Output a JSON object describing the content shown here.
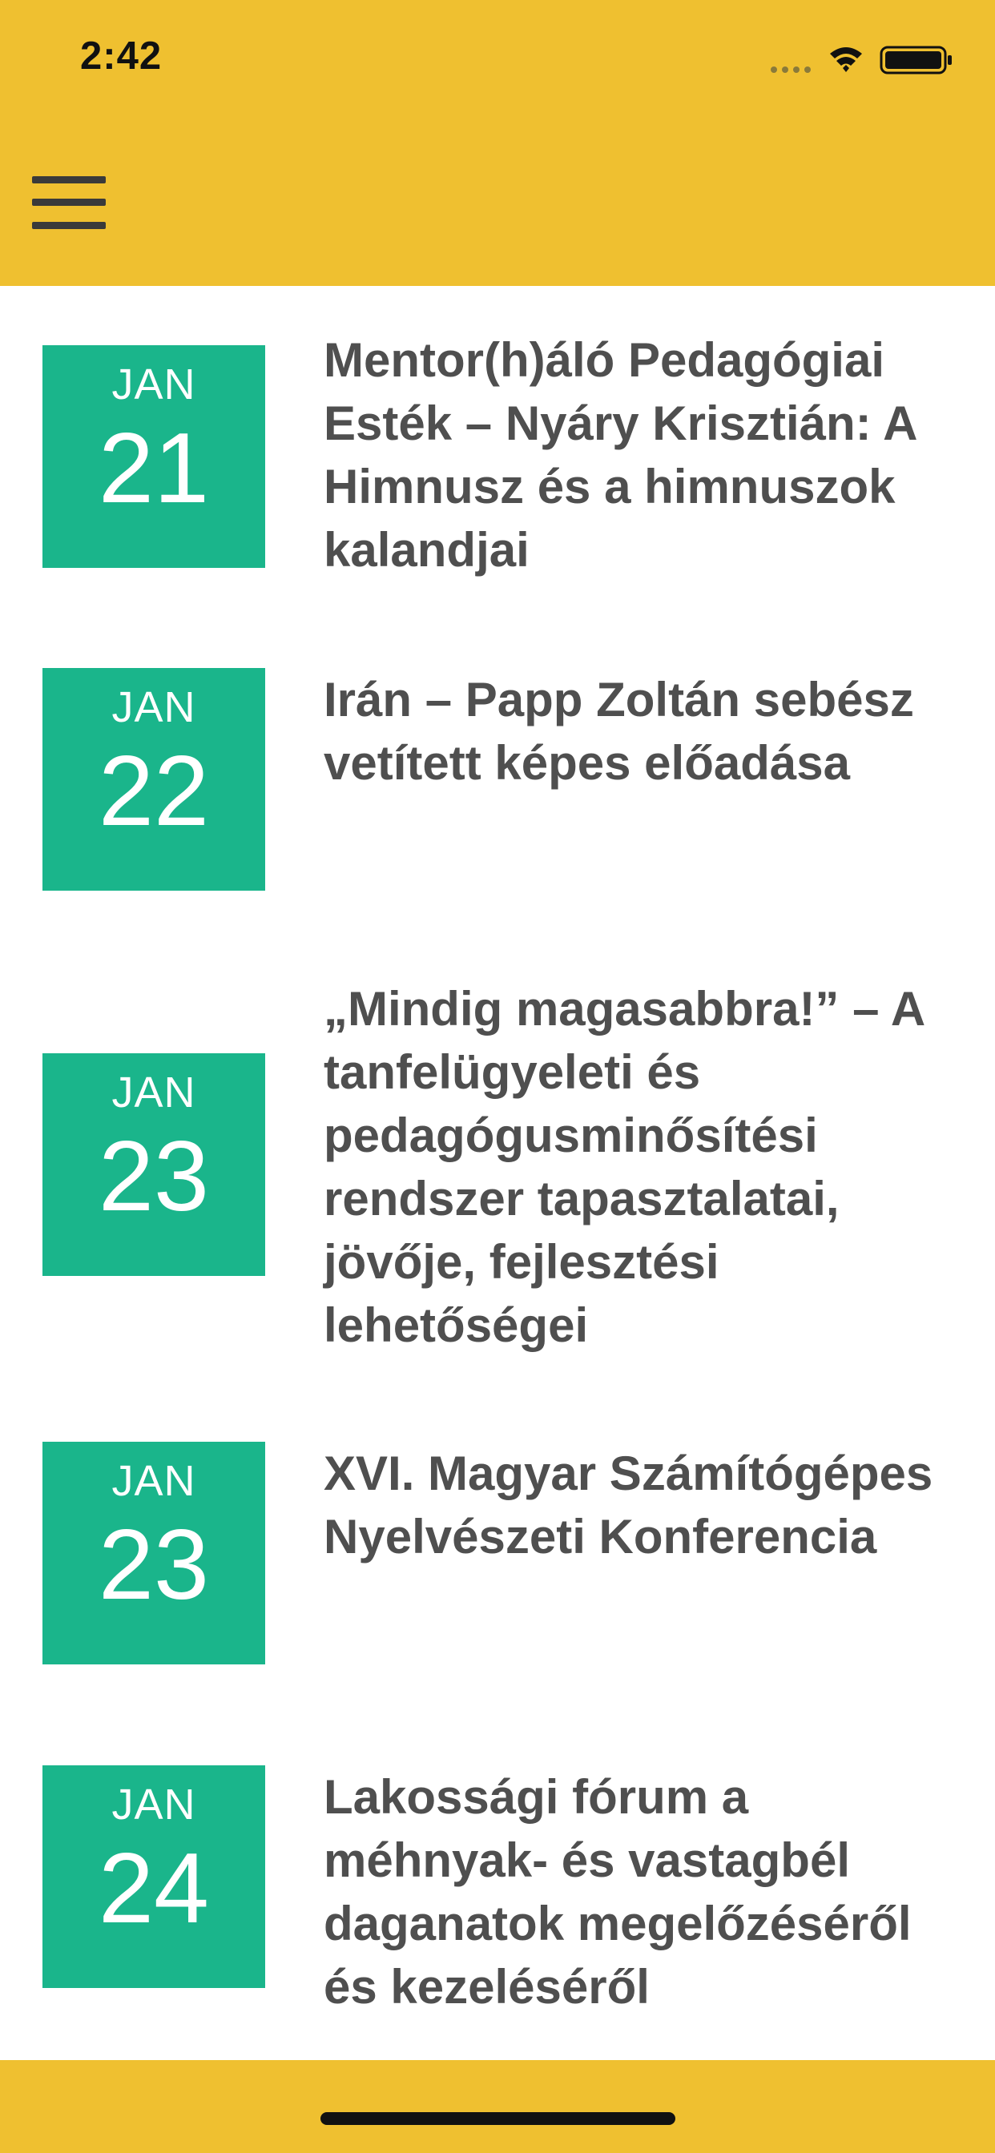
{
  "status_bar": {
    "time": "2:42",
    "icons": [
      "signal-icon",
      "wifi-icon",
      "battery-icon"
    ]
  },
  "nav": {
    "menu_icon": "hamburger-menu-icon"
  },
  "events": [
    {
      "month": "JAN",
      "day": "21",
      "title": "Mentor(h)áló Pedagógiai Esték – Nyáry Krisztián: A Himnusz és a himnuszok kalandjai"
    },
    {
      "month": "JAN",
      "day": "22",
      "title": "Irán – Papp Zoltán sebész vetített képes előadása"
    },
    {
      "month": "JAN",
      "day": "23",
      "title": "„Mindig magasabbra!” – A tanfelügyeleti és pedagógusminősítési rendszer tapasztalatai, jövője, fejlesztési lehetőségei"
    },
    {
      "month": "JAN",
      "day": "23",
      "title": "XVI. Magyar Számítógépes Nyelvészeti Konferencia"
    },
    {
      "month": "JAN",
      "day": "24",
      "title": "Lakossági fórum a méhnyak- és vastagbél daganatok megelőzéséről és kezeléséről"
    }
  ],
  "colors": {
    "header": "#EFC030",
    "date_box": "#1AB58B",
    "title_text": "#4F4F4F"
  }
}
